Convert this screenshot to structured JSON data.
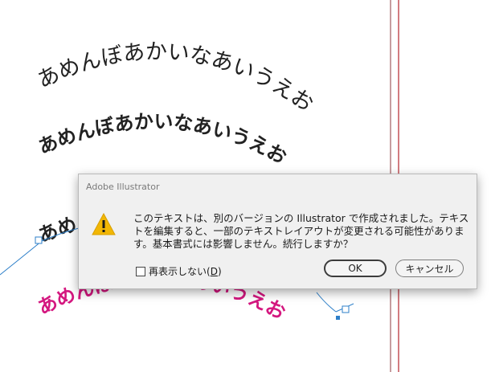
{
  "artboard": {
    "line1": "あめんぼあかいなあいうえお",
    "line2": "あめんぼあかいなあいうえお",
    "line3": "あめんぼ",
    "line4": "あめんぼあかいなあいうえお",
    "colors": {
      "text": "#222222",
      "magenta": "#d4177f",
      "guide_red": "#b3262d",
      "selection": "#2d7fc9"
    }
  },
  "dialog": {
    "title": "Adobe Illustrator",
    "icon": "warning-icon",
    "message_lines": [
      "このテキストは、別のバージョンの Illustrator で作成されました。テキス",
      "トを編集すると、一部のテキストレイアウトが変更される可能性がありま",
      "す。基本書式には影響しません。続行しますか？"
    ],
    "checkbox": {
      "label": "再表示しない",
      "shortcut_open": " (",
      "shortcut": "D",
      "shortcut_close": ")",
      "checked": false
    },
    "ok_label": "OK",
    "cancel_label": "キャンセル",
    "cancel_prefix": "",
    "colors": {
      "warning": "#f2b705",
      "border": "#b9b9b9"
    }
  }
}
